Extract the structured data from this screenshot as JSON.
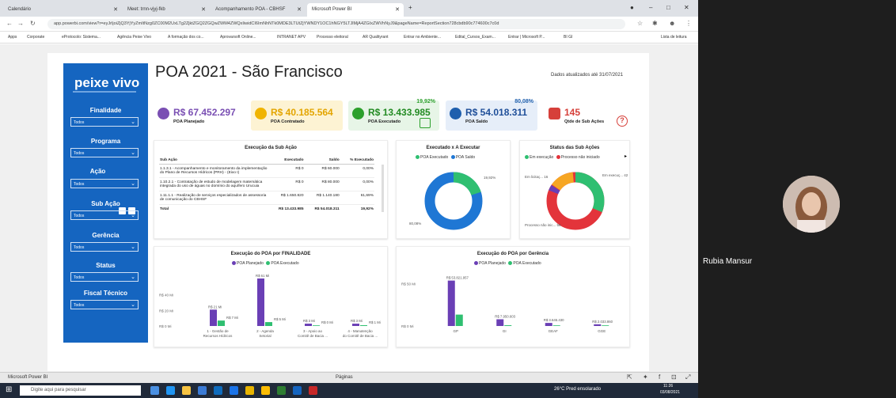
{
  "browser": {
    "tabs": [
      {
        "label": "Calendário"
      },
      {
        "label": "Meet: trnn-vjyj-fkb"
      },
      {
        "label": "Acompanhamento POA - CBHSF"
      },
      {
        "label": "Microsoft Power BI"
      }
    ],
    "url": "app.powerbi.com/view?r=eyJrIjoiZjQ3YjYyZmItNzg0ZC00M2UxLTg2ZjktZGQ2ZGQwZWM4ZWQxIiwidCI6ImNhNTk0MDE3LTUtZjYWNDY1OC1hNGY5LTJlMjA4ZGIxZWVhNyJ9&pageName=ReportSection728cbdb90c774600c7c0d",
    "bookmarks": [
      "Apps",
      "Corporate",
      "eProtocolo: Sistema...",
      "Agência Peixe Vivo",
      "A formação dos co...",
      "Aprovarsoft Online...",
      "INTRANET APV",
      "Processo eleitoral",
      "AR Qualityrant",
      "Entrar no Ambiente...",
      "Edital_Cursos_Exam...",
      "Entrar | Microsoft P...",
      "BI GI",
      "Lista de leitura"
    ]
  },
  "report": {
    "logo": "peixe vivo",
    "title": "POA 2021 - São Francisco",
    "updated": "Dados atualizados até 31/07/2021",
    "filters": [
      {
        "label": "Finalidade",
        "value": "Todos"
      },
      {
        "label": "Programa",
        "value": "Todos"
      },
      {
        "label": "Ação",
        "value": "Todos"
      },
      {
        "label": "Sub Ação",
        "value": "Todos"
      },
      {
        "label": "Gerência",
        "value": "Todos"
      },
      {
        "label": "Status",
        "value": "Todos"
      },
      {
        "label": "Fiscal Técnico",
        "value": "Todos"
      }
    ],
    "kpis": [
      {
        "value": "R$ 67.452.297",
        "label": "POA Planejado",
        "color": "#7a4fb3",
        "bg": "#ffffff"
      },
      {
        "value": "R$ 40.185.564",
        "label": "POA Contratado",
        "color": "#f0b400",
        "bg": "#fdf3d3"
      },
      {
        "value": "R$ 13.433.985",
        "label": "POA Executado",
        "pct": "19,92%",
        "color": "#2ca02c",
        "bg": "#e7f5e7"
      },
      {
        "value": "R$ 54.018.311",
        "label": "POA Saldo",
        "pct": "80,08%",
        "color": "#1f5fad",
        "bg": "#e6eef9"
      },
      {
        "value": "145",
        "label": "Qtde de Sub Ações",
        "color": "#d6403a",
        "bg": "#ffffff"
      }
    ],
    "exec_table": {
      "title": "Execução da Sub Ação",
      "headers": [
        "Sub Ação",
        "Executado",
        "Saldo",
        "% Executado"
      ],
      "rows": [
        [
          "1.1.3.1 - Acompanhamento e monitoramento da implementação do Plano de Recursos Hídricos (PRH) - (Eixo I)",
          "R$ 0",
          "R$ 60.000",
          "0,00%"
        ],
        [
          "1.10.2.1 - Contratação de estudo de modelagem matemática integrada do uso de águas no domínio do aquífero Urucuia",
          "R$ 0",
          "R$ 80.000",
          "0,00%"
        ],
        [
          "1.11.1.1 - Realização de serviços especializados de assessoria de comunicação do CBHSF",
          "R$ 1.650.820",
          "R$ 1.140.180",
          "61,69%"
        ]
      ],
      "total": [
        "Total",
        "R$ 13.433.985",
        "R$ 54.018.311",
        "19,92%"
      ]
    },
    "donut1": {
      "title": "Executado x A Executar",
      "legend": [
        "POA Executado",
        "POA Saldo"
      ],
      "labels": [
        "19,92%",
        "80,08%"
      ]
    },
    "donut2": {
      "title": "Status das Sub Ações",
      "legend": [
        "Em execução",
        "Processo não iniciado"
      ],
      "labels": [
        "Em licitaç... 16",
        "Em execuç... 42",
        "Processo não inic... 56"
      ]
    },
    "colors": {
      "planned": "#6a3fb5",
      "executed": "#2fbf71",
      "saldo": "#1f77d4",
      "contract": "#f6a623",
      "red": "#e3343b",
      "teal": "#19b1a8"
    }
  },
  "chart_data": [
    {
      "type": "bar",
      "title": "Execução do POA por FINALIDADE",
      "categories": [
        "1 - Gestão de Recursos Hídricos",
        "2 - Agenda Setorial",
        "3 - Apoio ao Comitê de Bacia ...",
        "4 - Manutenção do Comitê de Bacia ..."
      ],
      "series": [
        {
          "name": "POA Planejado",
          "values": [
            21,
            61,
            3,
            3
          ],
          "labels": [
            "R$ 21 Mi",
            "R$ 61 Mi",
            "R$ 3 Mi",
            "R$ 3 Mi"
          ]
        },
        {
          "name": "POA Executado",
          "values": [
            7,
            5,
            0,
            1
          ],
          "labels": [
            "R$ 7 Mi",
            "R$ 5 Mi",
            "R$ 0 Mi",
            "R$ 1 Mi"
          ]
        }
      ],
      "yticks": [
        "R$ 0 Mi",
        "R$ 20 Mi",
        "R$ 40 Mi"
      ],
      "ylim": [
        0,
        65
      ]
    },
    {
      "type": "bar",
      "title": "Execução do POA por Gerência",
      "categories": [
        "GP",
        "GI",
        "GEAF",
        "GGE"
      ],
      "series": [
        {
          "name": "POA Planejado",
          "values": [
            53821957,
            7950603,
            3646430,
            2033860
          ],
          "labels": [
            "R$ 53.821.957",
            "R$ 7.950.603",
            "R$ 3.646.430",
            "R$ 2.033.860"
          ]
        },
        {
          "name": "POA Executado",
          "values": [
            13500000,
            900000,
            300000,
            150000
          ]
        }
      ],
      "yticks": [
        "R$ 0 Mi",
        "R$ 50 Mi"
      ],
      "ylim": [
        0,
        60000000
      ]
    }
  ],
  "pbi": {
    "footer_left": "Microsoft Power BI",
    "footer_center": "Páginas"
  },
  "taskbar": {
    "search_placeholder": "Digite aqui para pesquisar",
    "weather": "26°C Pred ensolarado",
    "time": "11:26",
    "date": "03/08/2021"
  },
  "meet": {
    "participant": "Rubia Mansur"
  }
}
